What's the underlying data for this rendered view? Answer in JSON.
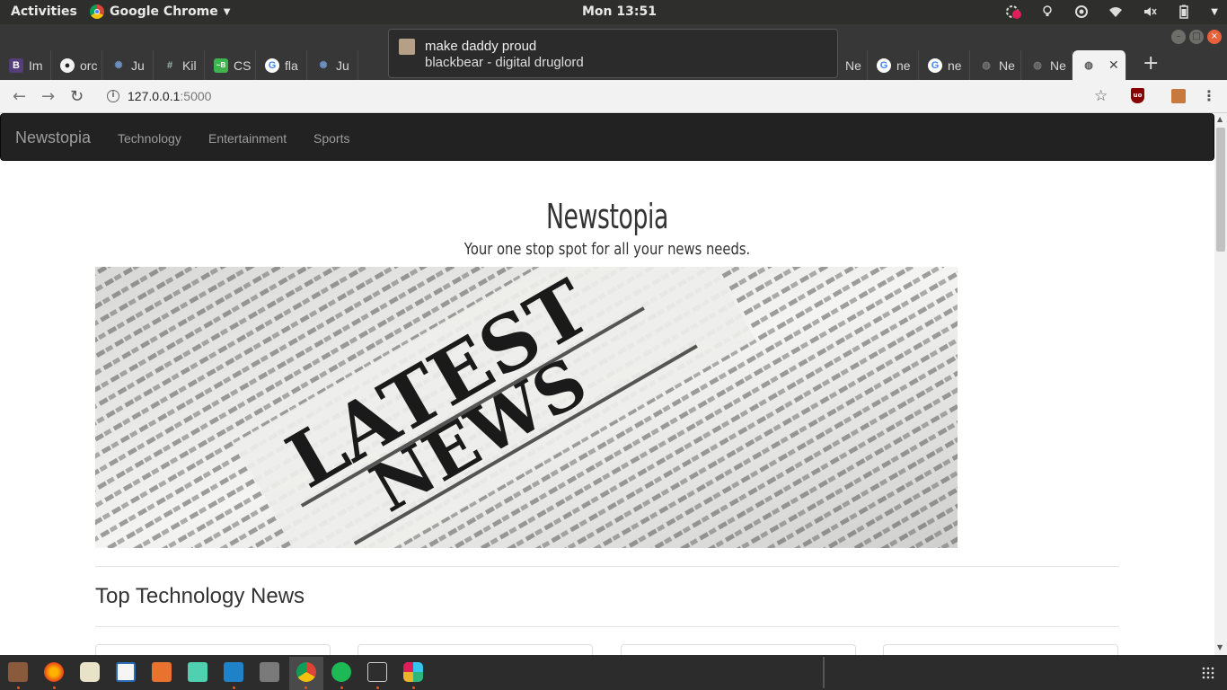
{
  "system": {
    "activities": "Activities",
    "app_name": "Google Chrome",
    "clock": "Mon 13:51"
  },
  "tabs": [
    {
      "label": "Im",
      "favicon": "bootstrap-icon",
      "color": "#563d7c"
    },
    {
      "label": "orc",
      "favicon": "github-icon",
      "color": "#333333"
    },
    {
      "label": "Ju",
      "favicon": "jupyter-icon",
      "color": "#3b5998"
    },
    {
      "label": "Kil",
      "favicon": "hash-icon",
      "color": "#2c3e50"
    },
    {
      "label": "CS",
      "favicon": "cs-icon",
      "color": "#3fb34f"
    },
    {
      "label": "fla",
      "favicon": "google-icon",
      "color": "#4285f4"
    },
    {
      "label": "Ju",
      "favicon": "jupyter-icon",
      "color": "#3b5998"
    },
    {
      "label": "Ne",
      "favicon": "globe-icon",
      "color": "#777777"
    },
    {
      "label": "ne",
      "favicon": "google-icon",
      "color": "#4285f4"
    },
    {
      "label": "ne",
      "favicon": "google-icon",
      "color": "#4285f4"
    },
    {
      "label": "Ne",
      "favicon": "globe-icon",
      "color": "#777777"
    },
    {
      "label": "Ne",
      "favicon": "globe-icon",
      "color": "#777777"
    }
  ],
  "notification": {
    "title": "make daddy proud",
    "body": "blackbear - digital druglord"
  },
  "address": {
    "host": "127.0.0.1",
    "port": ":5000"
  },
  "site": {
    "brand": "Newstopia",
    "nav": [
      "Technology",
      "Entertainment",
      "Sports"
    ],
    "hero_title": "Newstopia",
    "hero_subtitle": "Your one stop spot for all your news needs.",
    "hero_image_text": [
      "LATEST",
      "NEWS"
    ],
    "section_title": "Top Technology News"
  }
}
